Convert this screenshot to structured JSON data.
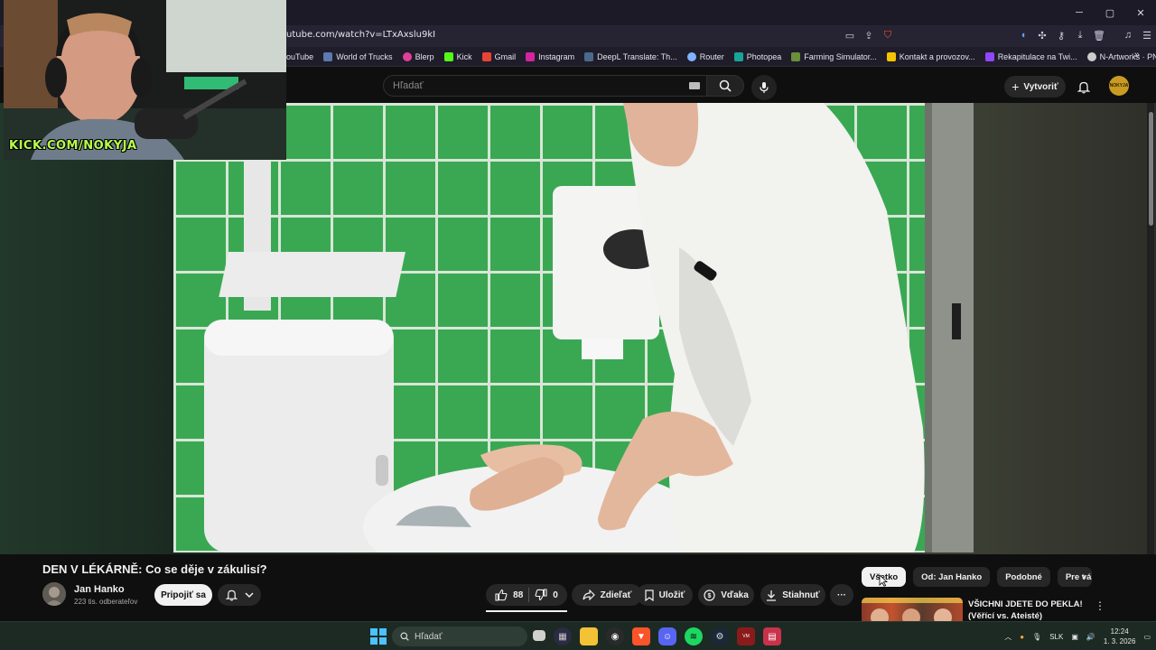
{
  "browser": {
    "url": "utube.com/watch?v=LTxAxslu9kI",
    "window_controls": {
      "minimize": "─",
      "maximize": "▢",
      "close": "✕"
    },
    "bookmarks": [
      {
        "label": "YouTube",
        "display": "ouTube",
        "color": "#ff0000"
      },
      {
        "label": "World of Trucks",
        "color": "#5a7ab0"
      },
      {
        "label": "Blerp",
        "color": "#e0409a"
      },
      {
        "label": "Kick",
        "color": "#53fc18"
      },
      {
        "label": "Gmail",
        "color": "#ea4335"
      },
      {
        "label": "Instagram",
        "color": "#d6249f"
      },
      {
        "label": "DeepL Translate: Th...",
        "color": "#0f2b46"
      },
      {
        "label": "Router",
        "color": "#7fb2ff"
      },
      {
        "label": "Photopea",
        "color": "#18a497"
      },
      {
        "label": "Farming Simulator...",
        "color": "#6b8f3a"
      },
      {
        "label": "Kontakt a provozov...",
        "color": "#f5c400"
      },
      {
        "label": "Rekapitulace na Twi...",
        "color": "#9146ff"
      },
      {
        "label": "N-Artworks · PNG",
        "color": "#cccccc"
      }
    ],
    "bookmarks_more": "»"
  },
  "masthead": {
    "search_placeholder": "Hľadať",
    "create_label": "Vytvoriť",
    "avatar_text": "NOKYJA"
  },
  "webcam": {
    "overlay_text": "KICK.COM/NOKYJA"
  },
  "video": {
    "title": "DEN V LÉKÁRNĚ: Co se děje v zákulisí?",
    "channel": "Jan Hanko",
    "subscribers": "223 tis. odberateľov",
    "subscribe_label": "Pripojiť sa",
    "likes": "88",
    "dislikes": "0",
    "share_label": "Zdieľať",
    "save_label": "Uložiť",
    "thanks_label": "Vďaka",
    "download_label": "Stiahnuť",
    "more_label": "···"
  },
  "sidebar": {
    "chips": [
      {
        "label": "Všetko",
        "active": true
      },
      {
        "label": "Od: Jan Hanko",
        "active": false
      },
      {
        "label": "Podobné",
        "active": false
      },
      {
        "label": "Pre vás",
        "active": false
      }
    ],
    "recommendation": {
      "title_line1": "VŠICHNI JDETE DO PEKLA!",
      "title_line2": "(Věřící vs. Ateisté)"
    }
  },
  "taskbar": {
    "search_label": "Hľadať",
    "language": "SLK",
    "time": "12:24",
    "date": "1. 3. 2026"
  },
  "colors": {
    "yt_bg": "#0f0f0f",
    "pill_bg": "#272727",
    "tile_green": "#3fae58",
    "kick_green": "#b6ff4a"
  }
}
